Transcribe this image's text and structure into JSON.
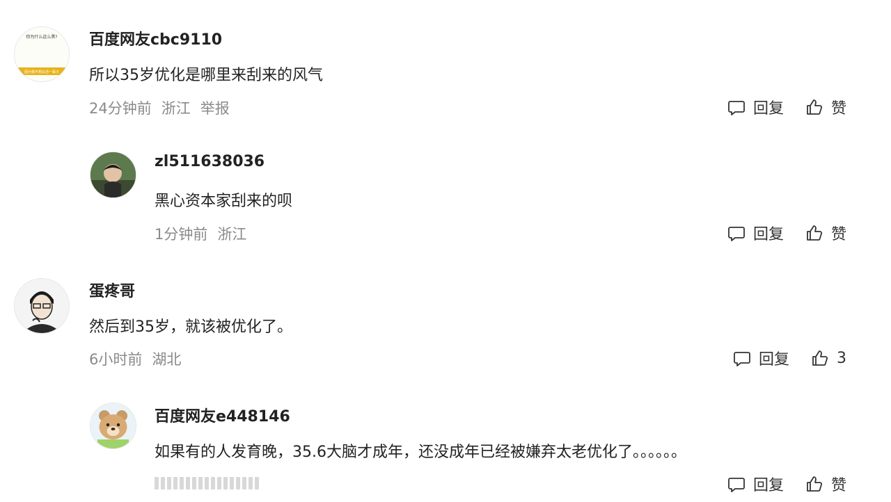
{
  "comments": [
    {
      "username": "百度网友cbc9110",
      "text": "所以35岁优化是哪里来刮来的风气",
      "time": "24分钟前",
      "location": "浙江",
      "report": "举报",
      "reply_label": "回复",
      "like_label": "赞",
      "avatar_caption_top": "你为什么这么黑?",
      "avatar_caption_bottom": "因为我不想白活一辈子"
    },
    {
      "username": "zl511638036",
      "text": "黑心资本家刮来的呗",
      "time": "1分钟前",
      "location": "浙江",
      "reply_label": "回复",
      "like_label": "赞"
    },
    {
      "username": "蛋疼哥",
      "text": "然后到35岁，就该被优化了。",
      "time": "6小时前",
      "location": "湖北",
      "reply_label": "回复",
      "like_label": "3"
    },
    {
      "username": "百度网友e448146",
      "text": "如果有的人发育晚，35.6大脑才成年，还没成年已经被嫌弃太老优化了。。。。。。",
      "reply_label": "回复",
      "like_label": "赞"
    }
  ],
  "colors": {
    "text": "#222222",
    "meta": "#8a8a8a",
    "action": "#333333"
  }
}
